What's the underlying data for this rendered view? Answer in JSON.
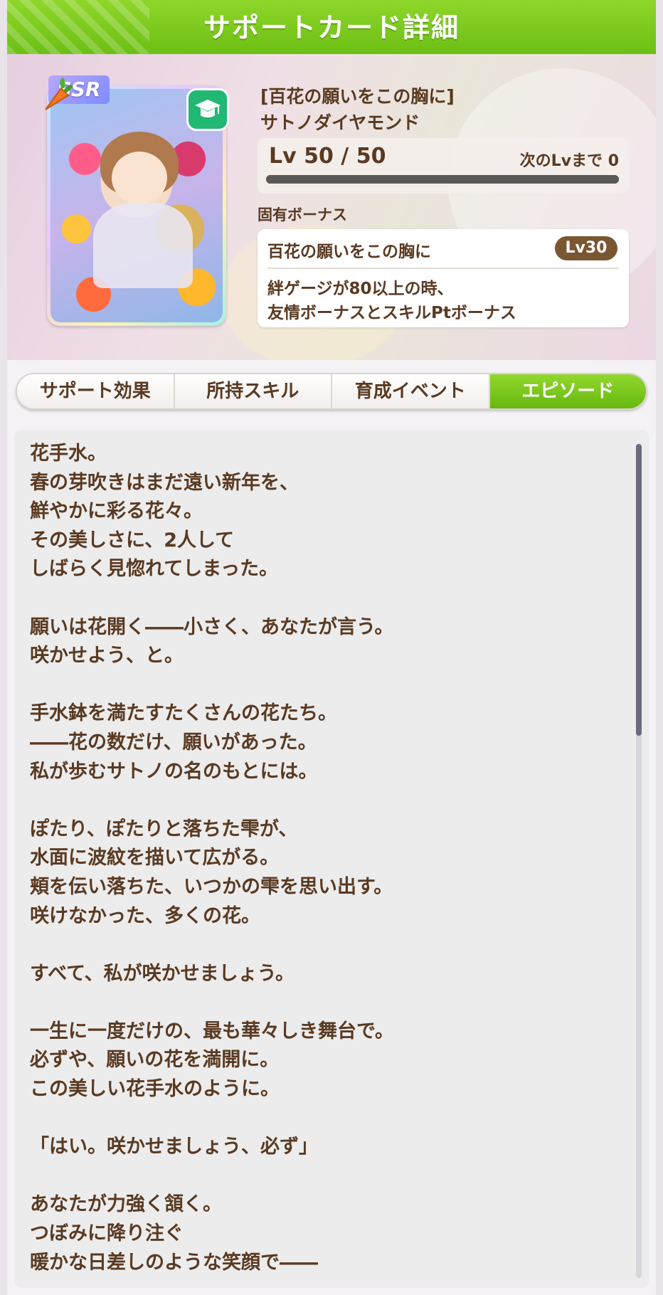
{
  "header": {
    "title": "サポートカード詳細"
  },
  "card": {
    "rarity": "SSR",
    "type_icon": "graduation-cap-icon",
    "subtitle": "[百花の願いをこの胸に]",
    "name": "サトノダイヤモンド",
    "level_text": "Lv 50 / 50",
    "next_level_text": "次のLvまで 0",
    "level_progress": 1.0
  },
  "unique_bonus": {
    "label": "固有ボーナス",
    "name": "百花の願いをこの胸に",
    "level_badge": "Lv30",
    "desc_line1": "絆ゲージが80以上の時、",
    "desc_line2": "友情ボーナスとスキルPtボーナス"
  },
  "tabs": [
    {
      "label": "サポート効果",
      "active": false
    },
    {
      "label": "所持スキル",
      "active": false
    },
    {
      "label": "育成イベント",
      "active": false
    },
    {
      "label": "エピソード",
      "active": true
    }
  ],
  "episode": {
    "lines": [
      "花手水。",
      "春の芽吹きはまだ遠い新年を、",
      "鮮やかに彩る花々。",
      "その美しさに、2人して",
      "しばらく見惚れてしまった。",
      "",
      "願いは花開く――小さく、あなたが言う。",
      "咲かせよう、と。",
      "",
      "手水鉢を満たすたくさんの花たち。",
      "――花の数だけ、願いがあった。",
      "私が歩むサトノの名のもとには。",
      "",
      "ぽたり、ぽたりと落ちた雫が、",
      "水面に波紋を描いて広がる。",
      "頬を伝い落ちた、いつかの雫を思い出す。",
      "咲けなかった、多くの花。",
      "",
      "すべて、私が咲かせましょう。",
      "",
      "一生に一度だけの、最も華々しき舞台で。",
      "必ずや、願いの花を満開に。",
      "この美しい花手水のように。",
      "",
      "「はい。咲かせましょう、必ず」",
      "",
      "あなたが力強く頷く。",
      "つぼみに降り注ぐ",
      "暖かな日差しのような笑顔で――"
    ]
  },
  "colors": {
    "accent_green": "#7cc91f",
    "text_brown": "#5a3a22",
    "badge_brown": "#7a5632",
    "type_green": "#21b874"
  }
}
